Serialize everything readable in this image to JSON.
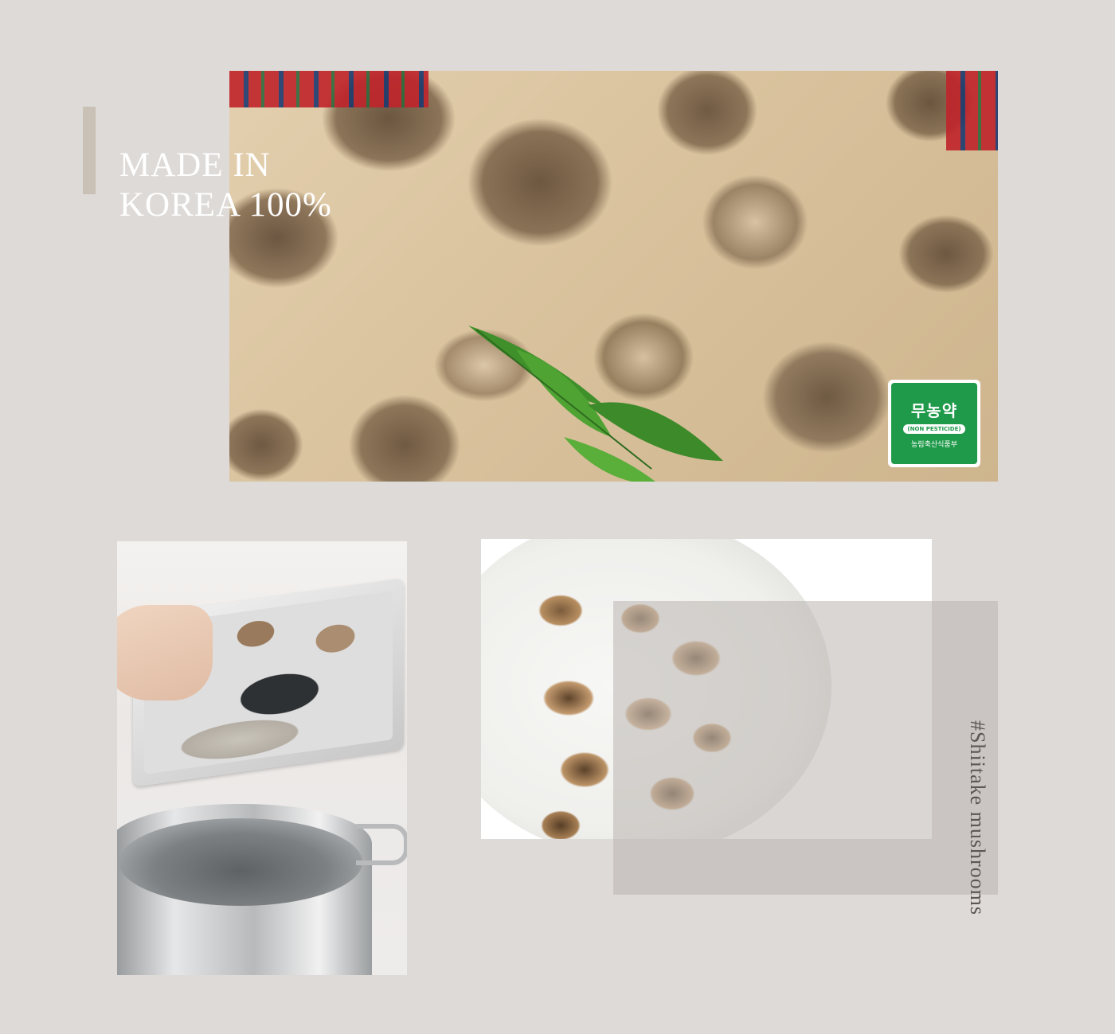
{
  "headline": {
    "line1": "MADE IN",
    "line2": "KOREA 100%"
  },
  "badge": {
    "korean": "무농약",
    "english": "(NON PESTICIDE)",
    "ministry": "농림축산식품부"
  },
  "caption": "#Shiitake mushrooms",
  "colors": {
    "background": "#dedad7",
    "accent_bar": "#c9c1b5",
    "badge_green": "#1f9a4a",
    "caption_text": "#5b5652"
  }
}
